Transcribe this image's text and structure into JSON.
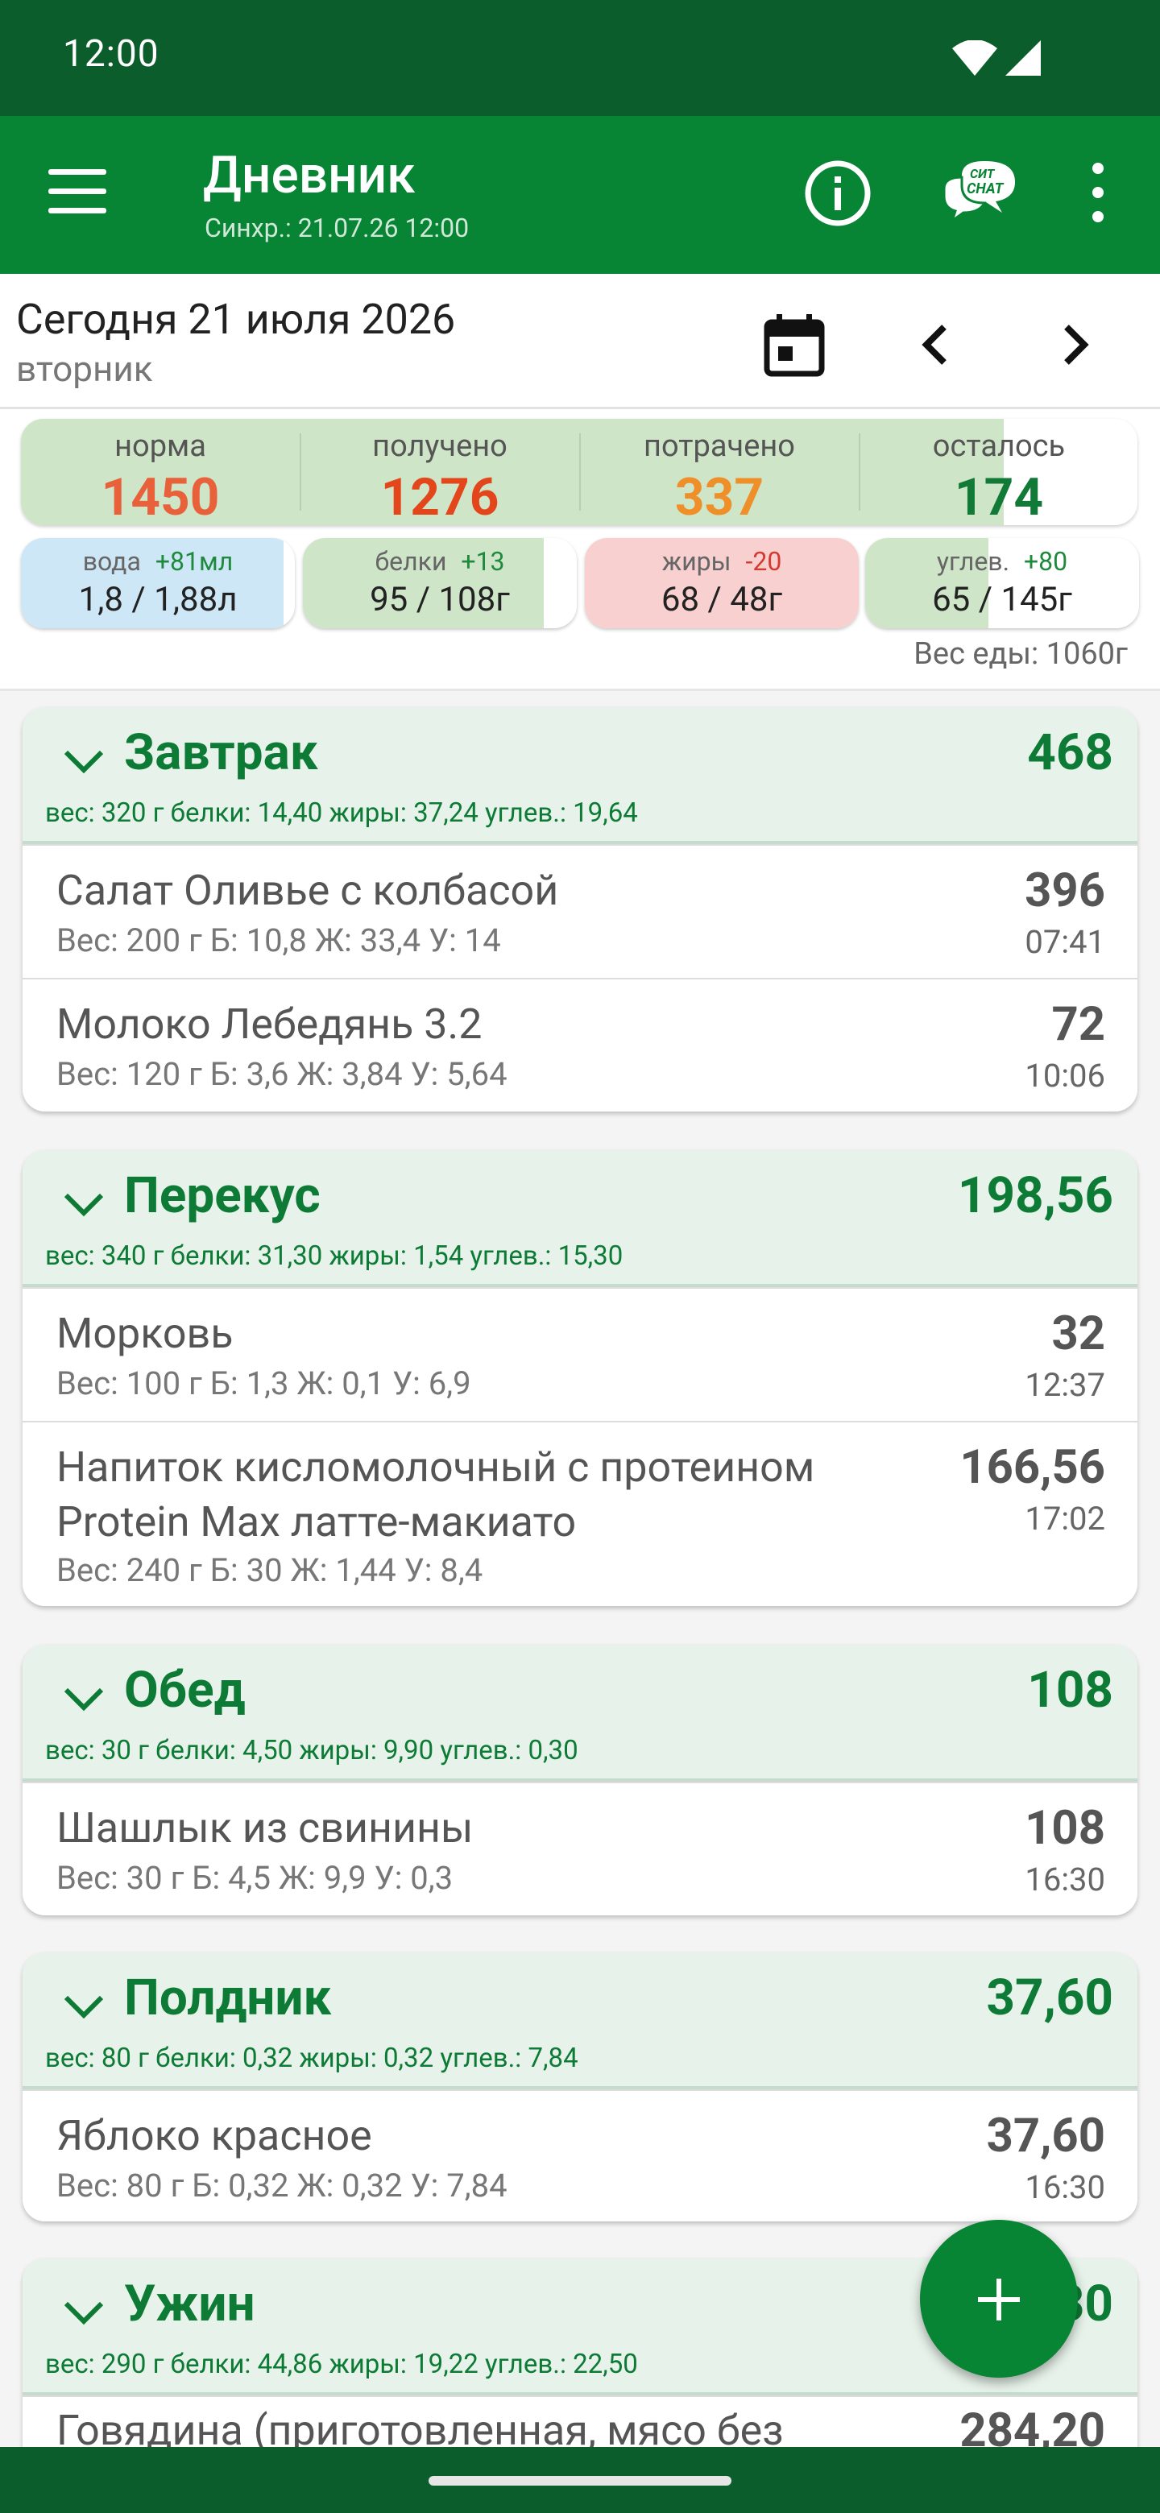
{
  "status_bar": {
    "time": "12:00"
  },
  "app_bar": {
    "title": "Дневник",
    "subtitle": "Синхр.: 21.07.26 12:00",
    "chat_badge_top": "СИТ",
    "chat_badge_bottom": "CHAT"
  },
  "date_row": {
    "date": "Сегодня 21 июля 2026",
    "weekday": "вторник"
  },
  "calories": {
    "norm": {
      "label": "норма",
      "value": "1450",
      "color": "#e8613a"
    },
    "received": {
      "label": "получено",
      "value": "1276",
      "color": "#e2461a"
    },
    "spent": {
      "label": "потрачено",
      "value": "337",
      "color": "#ef8f29"
    },
    "left": {
      "label": "осталось",
      "value": "174",
      "color": "#117a36"
    },
    "progress": 0.88
  },
  "macros": [
    {
      "label": "вода",
      "delta": "+81мл",
      "delta_color": "#1f8a3d",
      "value": "1,8 / 1,88л",
      "fill": "#cde7f6",
      "progress": 0.96
    },
    {
      "label": "белки",
      "delta": "+13",
      "delta_color": "#1f8a3d",
      "value": "95 / 108г",
      "fill": "#cfe5c8",
      "progress": 0.88
    },
    {
      "label": "жиры",
      "delta": "-20",
      "delta_color": "#d43a2f",
      "value": "68 / 48г",
      "fill": "#f8d0d0",
      "progress": 1.0
    },
    {
      "label": "углев.",
      "delta": "+80",
      "delta_color": "#1f8a3d",
      "value": "65 / 145г",
      "fill": "#cfe5c8",
      "progress": 0.45
    }
  ],
  "food_weight": "Вес еды: 1060г",
  "meals": [
    {
      "name": "Завтрак",
      "kcal": "468",
      "summary": "вес: 320 г  белки: 14,40  жиры: 37,24  углев.: 19,64",
      "items": [
        {
          "name": "Салат Оливье с колбасой",
          "macros": "Вес: 200 г  Б: 10,8  Ж: 33,4  У: 14",
          "kcal": "396",
          "time": "07:41"
        },
        {
          "name": "Молоко Лебедянь 3.2",
          "macros": "Вес: 120 г  Б: 3,6  Ж: 3,84  У: 5,64",
          "kcal": "72",
          "time": "10:06"
        }
      ]
    },
    {
      "name": "Перекус",
      "kcal": "198,56",
      "summary": "вес: 340 г  белки: 31,30  жиры: 1,54  углев.: 15,30",
      "items": [
        {
          "name": "Морковь",
          "macros": "Вес: 100 г  Б: 1,3  Ж: 0,1  У: 6,9",
          "kcal": "32",
          "time": "12:37"
        },
        {
          "name": "Напиток кисломолочный с протеином Protein Max латте-макиато",
          "macros": "Вес: 240 г  Б: 30  Ж: 1,44  У: 8,4",
          "kcal": "166,56",
          "time": "17:02"
        }
      ]
    },
    {
      "name": "Обед",
      "kcal": "108",
      "summary": "вес: 30 г  белки: 4,50  жиры: 9,90  углев.: 0,30",
      "items": [
        {
          "name": "Шашлык из свинины",
          "macros": "Вес: 30 г  Б: 4,5  Ж: 9,9  У: 0,3",
          "kcal": "108",
          "time": "16:30"
        }
      ]
    },
    {
      "name": "Полдник",
      "kcal": "37,60",
      "summary": "вес: 80 г  белки: 0,32  жиры: 0,32  углев.: 7,84",
      "items": [
        {
          "name": "Яблоко красное",
          "macros": "Вес: 80 г  Б: 0,32  Ж: 0,32  У: 7,84",
          "kcal": "37,60",
          "time": "16:30"
        }
      ]
    },
    {
      "name": "Ужин",
      "kcal": "30",
      "summary": "вес: 290 г  белки: 44,86  жиры: 19,22  углев.: 22,50",
      "items": [
        {
          "name": "Говядина (приготовленная, мясо без",
          "macros": "",
          "kcal": "284,20",
          "time": ""
        }
      ]
    }
  ],
  "icons": {
    "menu": "menu-icon",
    "info": "info-icon",
    "chat": "chat-icon",
    "more": "more-vert-icon",
    "calendar": "calendar-icon",
    "prev": "chevron-left-icon",
    "next": "chevron-right-icon",
    "collapse": "chevron-down-icon",
    "add": "plus-icon",
    "wifi": "wifi-icon",
    "signal": "signal-icon"
  },
  "colors": {
    "brand": "#078434",
    "status_bar": "#0b5e2b",
    "meal_header": "#e7f3ea",
    "meal_text": "#0d7a35"
  }
}
